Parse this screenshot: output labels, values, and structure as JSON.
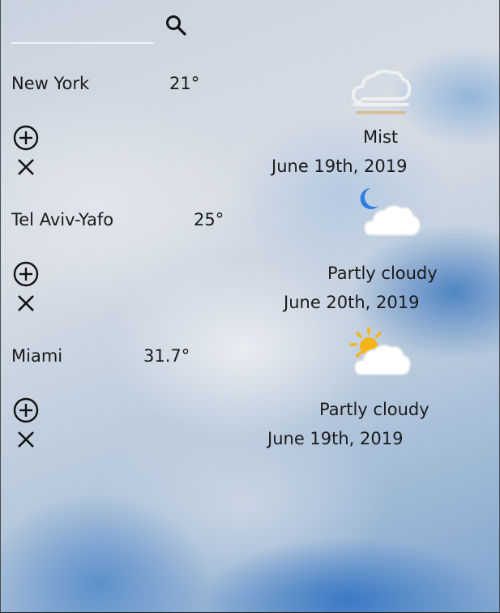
{
  "search": {
    "value": "",
    "placeholder": ""
  },
  "cities": [
    {
      "name": "New York",
      "temperature": "21°",
      "condition": "Mist",
      "date": "June 19th, 2019",
      "icon": "mist-icon"
    },
    {
      "name": "Tel Aviv-Yafo",
      "temperature": "25°",
      "condition": "Partly cloudy",
      "date": "June 20th, 2019",
      "icon": "partly-cloudy-night-icon"
    },
    {
      "name": "Miami",
      "temperature": "31.7°",
      "condition": "Partly cloudy",
      "date": "June 19th, 2019",
      "icon": "partly-cloudy-day-icon"
    }
  ],
  "colors": {
    "text": "#1a1a1a",
    "search_underline": "#f2f2f2",
    "moon": "#2f7de0",
    "sun": "#f6b41a",
    "cloud": "#ffffff"
  }
}
